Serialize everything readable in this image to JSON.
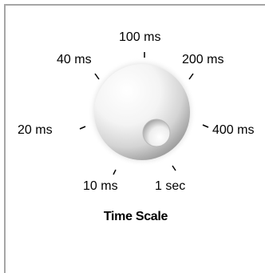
{
  "control": {
    "title": "Time Scale",
    "scale_labels": [
      "10 ms",
      "20 ms",
      "40 ms",
      "100 ms",
      "200 ms",
      "400 ms",
      "1 sec"
    ],
    "selected": "1 sec",
    "icon": "knob-icon"
  },
  "colors": {
    "border": "#a6a6a6",
    "background": "#ffffff",
    "knob_highlight": "#ffffff",
    "knob_shadow": "#8c8c8c"
  }
}
